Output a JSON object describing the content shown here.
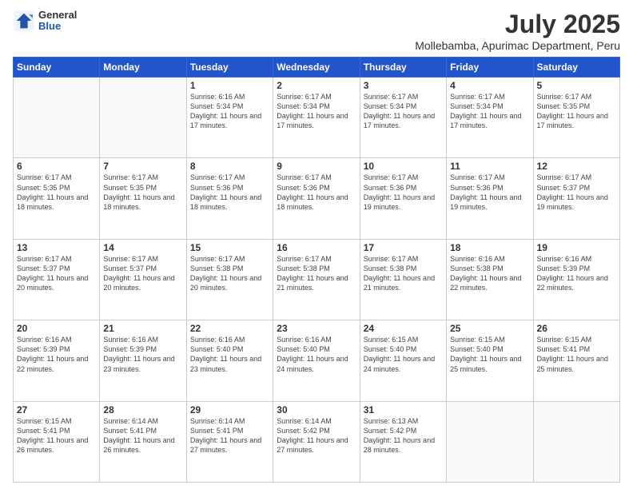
{
  "logo": {
    "line1": "General",
    "line2": "Blue"
  },
  "title": "July 2025",
  "subtitle": "Mollebamba, Apurimac Department, Peru",
  "days_of_week": [
    "Sunday",
    "Monday",
    "Tuesday",
    "Wednesday",
    "Thursday",
    "Friday",
    "Saturday"
  ],
  "weeks": [
    [
      {
        "day": "",
        "info": ""
      },
      {
        "day": "",
        "info": ""
      },
      {
        "day": "1",
        "info": "Sunrise: 6:16 AM\nSunset: 5:34 PM\nDaylight: 11 hours and 17 minutes."
      },
      {
        "day": "2",
        "info": "Sunrise: 6:17 AM\nSunset: 5:34 PM\nDaylight: 11 hours and 17 minutes."
      },
      {
        "day": "3",
        "info": "Sunrise: 6:17 AM\nSunset: 5:34 PM\nDaylight: 11 hours and 17 minutes."
      },
      {
        "day": "4",
        "info": "Sunrise: 6:17 AM\nSunset: 5:34 PM\nDaylight: 11 hours and 17 minutes."
      },
      {
        "day": "5",
        "info": "Sunrise: 6:17 AM\nSunset: 5:35 PM\nDaylight: 11 hours and 17 minutes."
      }
    ],
    [
      {
        "day": "6",
        "info": "Sunrise: 6:17 AM\nSunset: 5:35 PM\nDaylight: 11 hours and 18 minutes."
      },
      {
        "day": "7",
        "info": "Sunrise: 6:17 AM\nSunset: 5:35 PM\nDaylight: 11 hours and 18 minutes."
      },
      {
        "day": "8",
        "info": "Sunrise: 6:17 AM\nSunset: 5:36 PM\nDaylight: 11 hours and 18 minutes."
      },
      {
        "day": "9",
        "info": "Sunrise: 6:17 AM\nSunset: 5:36 PM\nDaylight: 11 hours and 18 minutes."
      },
      {
        "day": "10",
        "info": "Sunrise: 6:17 AM\nSunset: 5:36 PM\nDaylight: 11 hours and 19 minutes."
      },
      {
        "day": "11",
        "info": "Sunrise: 6:17 AM\nSunset: 5:36 PM\nDaylight: 11 hours and 19 minutes."
      },
      {
        "day": "12",
        "info": "Sunrise: 6:17 AM\nSunset: 5:37 PM\nDaylight: 11 hours and 19 minutes."
      }
    ],
    [
      {
        "day": "13",
        "info": "Sunrise: 6:17 AM\nSunset: 5:37 PM\nDaylight: 11 hours and 20 minutes."
      },
      {
        "day": "14",
        "info": "Sunrise: 6:17 AM\nSunset: 5:37 PM\nDaylight: 11 hours and 20 minutes."
      },
      {
        "day": "15",
        "info": "Sunrise: 6:17 AM\nSunset: 5:38 PM\nDaylight: 11 hours and 20 minutes."
      },
      {
        "day": "16",
        "info": "Sunrise: 6:17 AM\nSunset: 5:38 PM\nDaylight: 11 hours and 21 minutes."
      },
      {
        "day": "17",
        "info": "Sunrise: 6:17 AM\nSunset: 5:38 PM\nDaylight: 11 hours and 21 minutes."
      },
      {
        "day": "18",
        "info": "Sunrise: 6:16 AM\nSunset: 5:38 PM\nDaylight: 11 hours and 22 minutes."
      },
      {
        "day": "19",
        "info": "Sunrise: 6:16 AM\nSunset: 5:39 PM\nDaylight: 11 hours and 22 minutes."
      }
    ],
    [
      {
        "day": "20",
        "info": "Sunrise: 6:16 AM\nSunset: 5:39 PM\nDaylight: 11 hours and 22 minutes."
      },
      {
        "day": "21",
        "info": "Sunrise: 6:16 AM\nSunset: 5:39 PM\nDaylight: 11 hours and 23 minutes."
      },
      {
        "day": "22",
        "info": "Sunrise: 6:16 AM\nSunset: 5:40 PM\nDaylight: 11 hours and 23 minutes."
      },
      {
        "day": "23",
        "info": "Sunrise: 6:16 AM\nSunset: 5:40 PM\nDaylight: 11 hours and 24 minutes."
      },
      {
        "day": "24",
        "info": "Sunrise: 6:15 AM\nSunset: 5:40 PM\nDaylight: 11 hours and 24 minutes."
      },
      {
        "day": "25",
        "info": "Sunrise: 6:15 AM\nSunset: 5:40 PM\nDaylight: 11 hours and 25 minutes."
      },
      {
        "day": "26",
        "info": "Sunrise: 6:15 AM\nSunset: 5:41 PM\nDaylight: 11 hours and 25 minutes."
      }
    ],
    [
      {
        "day": "27",
        "info": "Sunrise: 6:15 AM\nSunset: 5:41 PM\nDaylight: 11 hours and 26 minutes."
      },
      {
        "day": "28",
        "info": "Sunrise: 6:14 AM\nSunset: 5:41 PM\nDaylight: 11 hours and 26 minutes."
      },
      {
        "day": "29",
        "info": "Sunrise: 6:14 AM\nSunset: 5:41 PM\nDaylight: 11 hours and 27 minutes."
      },
      {
        "day": "30",
        "info": "Sunrise: 6:14 AM\nSunset: 5:42 PM\nDaylight: 11 hours and 27 minutes."
      },
      {
        "day": "31",
        "info": "Sunrise: 6:13 AM\nSunset: 5:42 PM\nDaylight: 11 hours and 28 minutes."
      },
      {
        "day": "",
        "info": ""
      },
      {
        "day": "",
        "info": ""
      }
    ]
  ]
}
